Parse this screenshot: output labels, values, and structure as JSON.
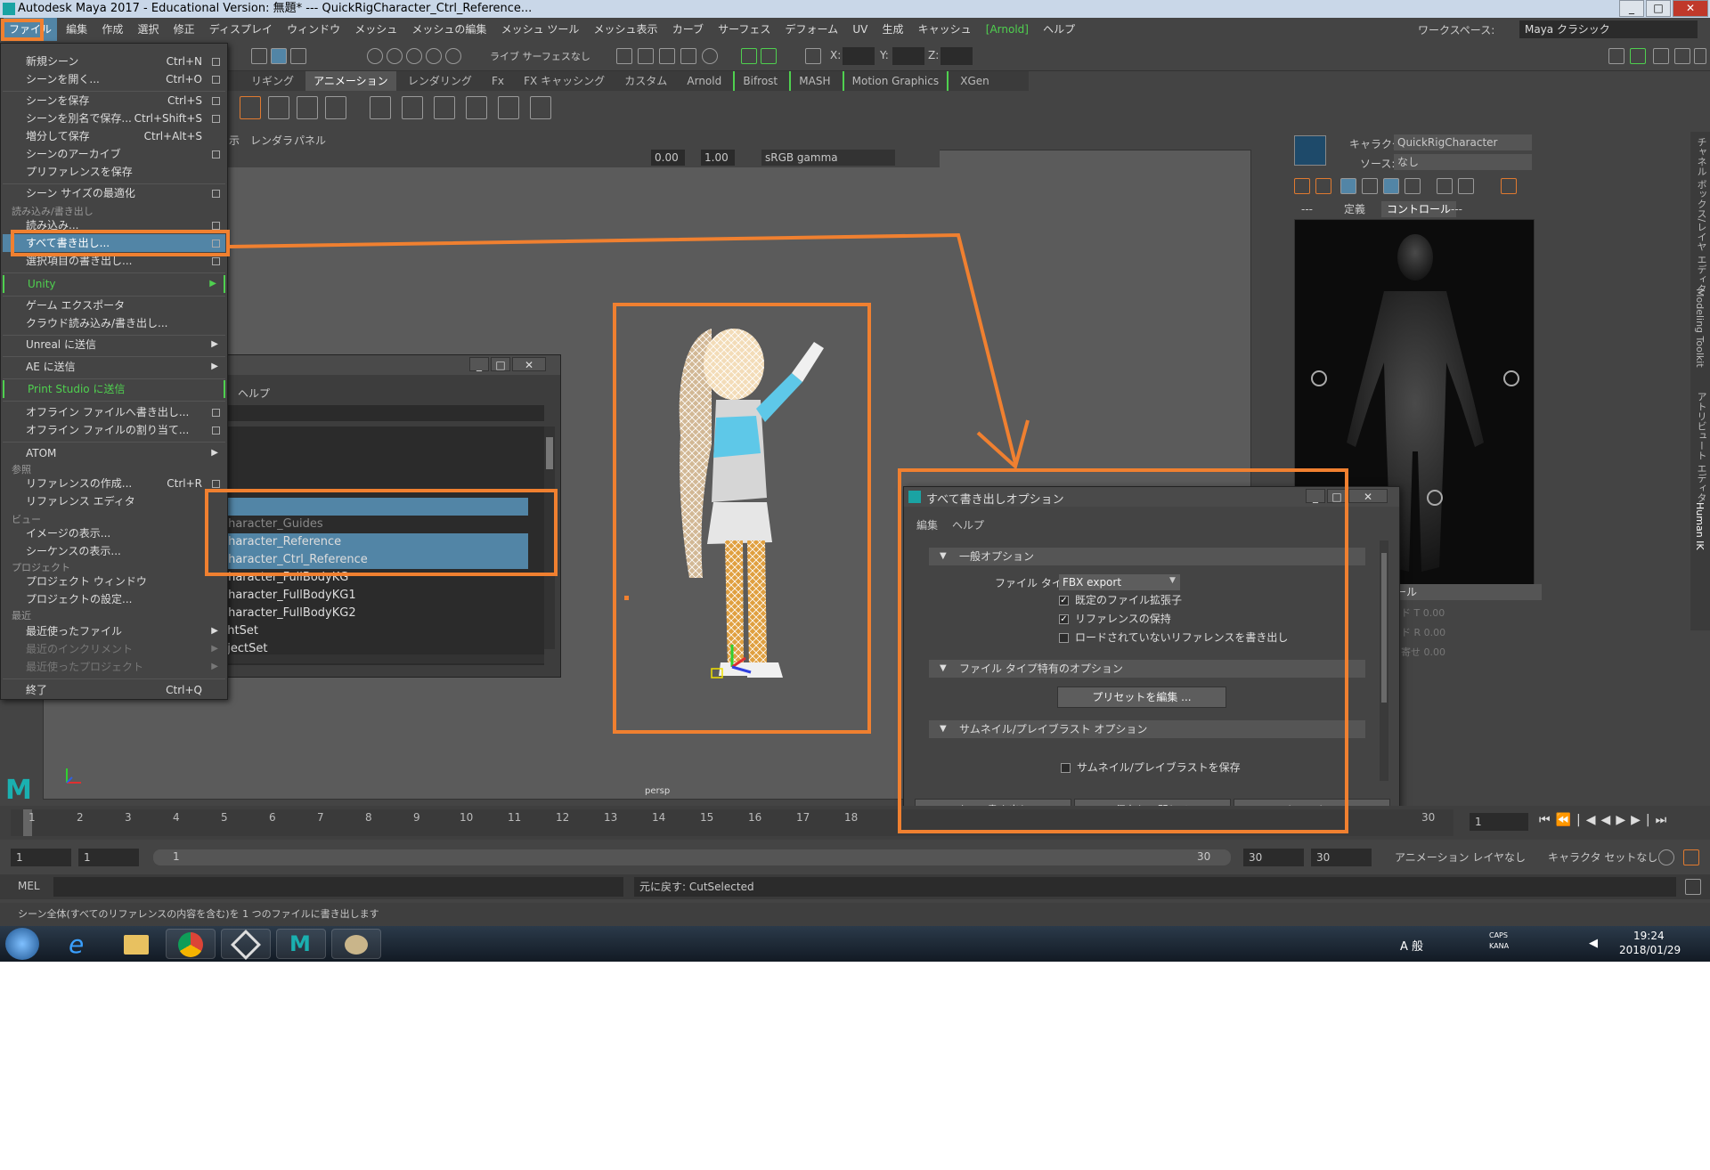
{
  "title": "Autodesk Maya 2017 - Educational Version: 無題*   ---   QuickRigCharacter_Ctrl_Reference...",
  "menu": [
    "ファイル",
    "編集",
    "作成",
    "選択",
    "修正",
    "ディスプレイ",
    "ウィンドウ",
    "メッシュ",
    "メッシュの編集",
    "メッシュ ツール",
    "メッシュ表示",
    "カーブ",
    "サーフェス",
    "デフォーム",
    "UV",
    "生成",
    "キャッシュ",
    "[Arnold]",
    "ヘルプ"
  ],
  "workspace": {
    "label": "ワークスペース:",
    "value": "Maya クラシック"
  },
  "toolbar": {
    "live_surface": "ライブ サーフェスなし",
    "x": "X:",
    "y": "Y:",
    "z": "Z:"
  },
  "shelf_tabs": [
    "リギング",
    "アニメーション",
    "レンダリング",
    "Fx",
    "FX キャッシング",
    "カスタム",
    "Arnold",
    "Bifrost",
    "MASH",
    "Motion Graphics",
    "XGen"
  ],
  "viewport": {
    "menus": [
      "示",
      "レンダラ",
      "パネル"
    ],
    "val1": "0.00",
    "val2": "1.00",
    "colorspace": "sRGB gamma",
    "camera": "persp"
  },
  "file_menu": {
    "items": [
      {
        "label": "新規シーン",
        "sc": "Ctrl+N",
        "cb": true
      },
      {
        "label": "シーンを開く...",
        "sc": "Ctrl+O",
        "cb": true
      },
      {
        "label": "シーンを保存",
        "sc": "Ctrl+S",
        "cb": true
      },
      {
        "label": "シーンを別名で保存...",
        "sc": "Ctrl+Shift+S",
        "cb": true
      },
      {
        "label": "増分して保存",
        "sc": "Ctrl+Alt+S",
        "cb": false
      },
      {
        "label": "シーンのアーカイブ",
        "sc": "",
        "cb": true
      },
      {
        "label": "プリファレンスを保存",
        "sc": "",
        "cb": false
      },
      {
        "label": "シーン サイズの最適化",
        "sc": "",
        "cb": true
      },
      {
        "label": "読み込み...",
        "sc": "",
        "cb": true
      },
      {
        "label": "すべて書き出し...",
        "sc": "",
        "cb": true
      },
      {
        "label": "選択項目の書き出し...",
        "sc": "",
        "cb": true
      },
      {
        "label": "Unity",
        "sc": "",
        "cb": false
      },
      {
        "label": "ゲーム エクスポータ",
        "sc": "",
        "cb": false
      },
      {
        "label": "クラウド読み込み/書き出し...",
        "sc": "",
        "cb": false
      },
      {
        "label": "Unreal に送信",
        "sc": "",
        "cb": false
      },
      {
        "label": "AE に送信",
        "sc": "",
        "cb": false
      },
      {
        "label": "Print Studio に送信",
        "sc": "",
        "cb": false
      },
      {
        "label": "オフライン ファイルへ書き出し...",
        "sc": "",
        "cb": true
      },
      {
        "label": "オフライン ファイルの割り当て...",
        "sc": "",
        "cb": true
      },
      {
        "label": "ATOM",
        "sc": "",
        "cb": false
      },
      {
        "label": "リファレンスの作成...",
        "sc": "Ctrl+R",
        "cb": true
      },
      {
        "label": "リファレンス エディタ",
        "sc": "",
        "cb": false
      },
      {
        "label": "イメージの表示...",
        "sc": "",
        "cb": false
      },
      {
        "label": "シーケンスの表示...",
        "sc": "",
        "cb": false
      },
      {
        "label": "プロジェクト ウィンドウ",
        "sc": "",
        "cb": false
      },
      {
        "label": "プロジェクトの設定...",
        "sc": "",
        "cb": false
      },
      {
        "label": "最近使ったファイル",
        "sc": "",
        "cb": false
      },
      {
        "label": "最近のインクリメント",
        "sc": "",
        "cb": false
      },
      {
        "label": "最近使ったプロジェクト",
        "sc": "",
        "cb": false
      },
      {
        "label": "終了",
        "sc": "Ctrl+Q",
        "cb": false
      }
    ],
    "sections": [
      "読み込み/書き出し",
      "参照",
      "ビュー",
      "プロジェクト",
      "最近"
    ]
  },
  "outliner": {
    "menu_help": "ヘルプ",
    "rows": [
      "n",
      "Character_Guides",
      "Character_Reference",
      "Character_Ctrl_Reference",
      "Character_FullBodyKG",
      "Character_FullBodyKG1",
      "Character_FullBodyKG2",
      "ghtSet",
      "bjectSet"
    ]
  },
  "hik": {
    "char_label": "キャラクタ:",
    "char_value": "QuickRigCharacter",
    "src_label": "ソース:",
    "src_value": "なし",
    "tabs": [
      "---",
      "定義",
      "コントロール",
      "---"
    ],
    "panel_label": "ロール",
    "rows": [
      {
        "label": "ド T",
        "value": "0.00"
      },
      {
        "label": "ド R",
        "value": "0.00"
      },
      {
        "label": "寄せ",
        "value": "0.00"
      }
    ]
  },
  "side_tabs": [
    "チャネル ボックス/レイヤ エディタ",
    "Modeling Toolkit",
    "アトリビュート エディタ",
    "Human IK"
  ],
  "dialog": {
    "title": "すべて書き出しオプション",
    "menus": [
      "編集",
      "ヘルプ"
    ],
    "sec_general": "一般オプション",
    "file_type_label": "ファイル タイプ:",
    "file_type": "FBX export",
    "cb1": "既定のファイル拡張子",
    "cb2": "リファレンスの保持",
    "cb3": "ロードされていないリファレンスを書き出し",
    "sec_specific": "ファイル タイプ特有のオプション",
    "preset_btn": "プリセットを編集 ...",
    "sec_thumb": "サムネイル/プレイブラスト オプション",
    "cb4": "サムネイル/プレイブラストを保存",
    "btn_export": "すべて書き出し",
    "btn_save_close": "保存して閉じる",
    "btn_cancel": "キャンセル"
  },
  "timeline": {
    "ticks": [
      "1",
      "2",
      "3",
      "4",
      "5",
      "6",
      "7",
      "8",
      "9",
      "10",
      "11",
      "12",
      "13",
      "14",
      "15",
      "16",
      "17",
      "18",
      "30"
    ],
    "current": "1"
  },
  "range": {
    "start": "1",
    "start2": "1",
    "slider_start": "1",
    "slider_end": "30",
    "end": "30",
    "end2": "30",
    "anim_layer": "アニメーション レイヤなし",
    "char_set": "キャラクタ セットなし"
  },
  "mel": {
    "label": "MEL",
    "result": "元に戻す: CutSelected"
  },
  "helpline": "シーン全体(すべてのリファレンスの内容を含む)を 1 つのファイルに書き出します",
  "tray": {
    "ime": "A 般",
    "caps": "CAPS",
    "kana": "KANA",
    "time": "19:24",
    "date": "2018/01/29"
  },
  "colors": {
    "highlight": "#f08030",
    "selection": "#5285a6",
    "unity_green": "#4fd04f"
  }
}
